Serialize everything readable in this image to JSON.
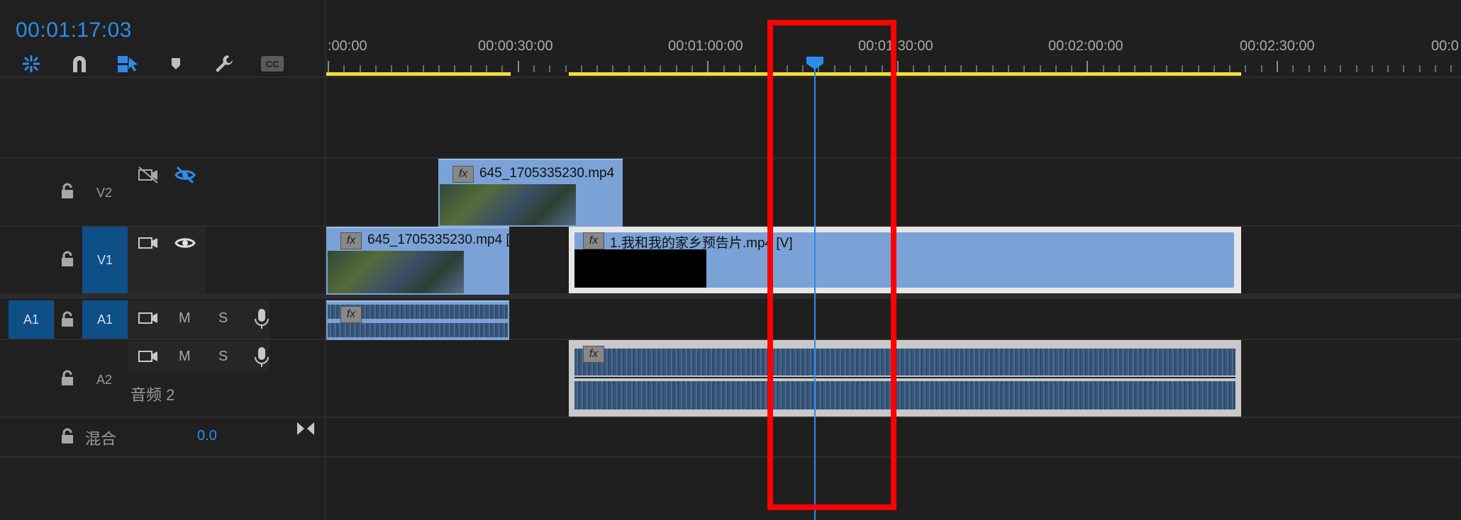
{
  "timecode": "00:01:17:03",
  "toolbar": [
    {
      "name": "ripple-snap-icon"
    },
    {
      "name": "magnet-snap-icon"
    },
    {
      "name": "linked-selection-icon"
    },
    {
      "name": "add-marker-icon"
    },
    {
      "name": "wrench-settings-icon"
    },
    {
      "name": "captions-cc-icon"
    }
  ],
  "ruler": {
    "labels": [
      ":00:00",
      "00:00:30:00",
      "00:01:00:00",
      "00:01:30:00",
      "00:02:00:00",
      "00:02:30:00",
      "00:0"
    ]
  },
  "tracks": {
    "v2": {
      "name": "V2"
    },
    "v1": {
      "name": "V1"
    },
    "a1": {
      "source": "A1",
      "name": "A1",
      "m": "M",
      "s": "S"
    },
    "a2": {
      "name": "A2",
      "m": "M",
      "s": "S",
      "label": "音频 2"
    },
    "mix": {
      "label": "混合",
      "value": "0.0"
    }
  },
  "clips": {
    "v2_clip": {
      "label": "645_1705335230.mp4",
      "fx": "fx"
    },
    "v1_clip1": {
      "label": "645_1705335230.mp4 [",
      "fx": "fx"
    },
    "v1_clip2": {
      "label": "1.我和我的家乡预告片.mp4 [V]",
      "fx": "fx"
    },
    "a1_clip": {
      "fx": "fx"
    },
    "a2_clip": {
      "fx": "fx"
    }
  },
  "colors": {
    "accent": "#2d8ceb",
    "clip_video": "#7aa2d6",
    "work_area": "#f3e033",
    "highlight": "#ff0000"
  }
}
